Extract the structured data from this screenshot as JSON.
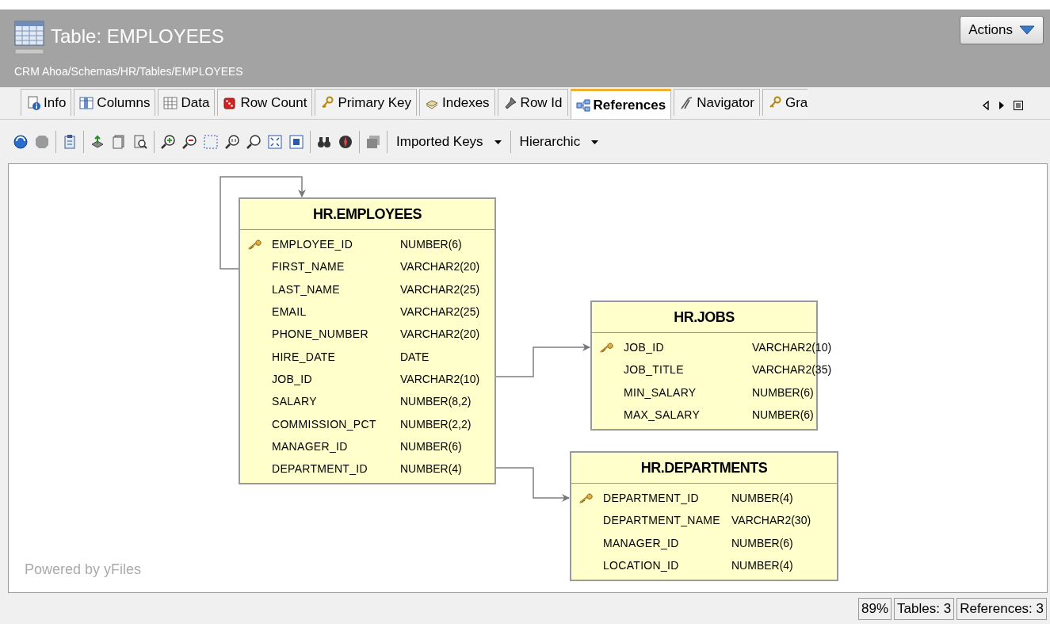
{
  "header": {
    "title": "Table: EMPLOYEES",
    "path": "CRM Ahoa/Schemas/HR/Tables/EMPLOYEES",
    "actions_button": "Actions"
  },
  "tabs": [
    {
      "label": "Info",
      "selected": false
    },
    {
      "label": "Columns",
      "selected": false
    },
    {
      "label": "Data",
      "selected": false
    },
    {
      "label": "Row Count",
      "selected": false
    },
    {
      "label": "Primary Key",
      "selected": false
    },
    {
      "label": "Indexes",
      "selected": false
    },
    {
      "label": "Row Id",
      "selected": false
    },
    {
      "label": "References",
      "selected": true
    },
    {
      "label": "Navigator",
      "selected": false
    },
    {
      "label": "Gra",
      "selected": false
    }
  ],
  "toolbar": {
    "dropdowns": [
      "Imported Keys",
      "Hierarchic"
    ]
  },
  "diagram": {
    "tables": [
      {
        "name": "HR.EMPLOYEES",
        "columns": [
          {
            "name": "EMPLOYEE_ID",
            "type": "NUMBER(6)",
            "primary_key": true
          },
          {
            "name": "FIRST_NAME",
            "type": "VARCHAR2(20)",
            "primary_key": false
          },
          {
            "name": "LAST_NAME",
            "type": "VARCHAR2(25)",
            "primary_key": false
          },
          {
            "name": "EMAIL",
            "type": "VARCHAR2(25)",
            "primary_key": false
          },
          {
            "name": "PHONE_NUMBER",
            "type": "VARCHAR2(20)",
            "primary_key": false
          },
          {
            "name": "HIRE_DATE",
            "type": "DATE",
            "primary_key": false
          },
          {
            "name": "JOB_ID",
            "type": "VARCHAR2(10)",
            "primary_key": false
          },
          {
            "name": "SALARY",
            "type": "NUMBER(8,2)",
            "primary_key": false
          },
          {
            "name": "COMMISSION_PCT",
            "type": "NUMBER(2,2)",
            "primary_key": false
          },
          {
            "name": "MANAGER_ID",
            "type": "NUMBER(6)",
            "primary_key": false
          },
          {
            "name": "DEPARTMENT_ID",
            "type": "NUMBER(4)",
            "primary_key": false
          }
        ]
      },
      {
        "name": "HR.JOBS",
        "columns": [
          {
            "name": "JOB_ID",
            "type": "VARCHAR2(10)",
            "primary_key": true
          },
          {
            "name": "JOB_TITLE",
            "type": "VARCHAR2(35)",
            "primary_key": false
          },
          {
            "name": "MIN_SALARY",
            "type": "NUMBER(6)",
            "primary_key": false
          },
          {
            "name": "MAX_SALARY",
            "type": "NUMBER(6)",
            "primary_key": false
          }
        ]
      },
      {
        "name": "HR.DEPARTMENTS",
        "columns": [
          {
            "name": "DEPARTMENT_ID",
            "type": "NUMBER(4)",
            "primary_key": true
          },
          {
            "name": "DEPARTMENT_NAME",
            "type": "VARCHAR2(30)",
            "primary_key": false
          },
          {
            "name": "MANAGER_ID",
            "type": "NUMBER(6)",
            "primary_key": false
          },
          {
            "name": "LOCATION_ID",
            "type": "NUMBER(4)",
            "primary_key": false
          }
        ]
      }
    ],
    "watermark": "Powered by yFiles"
  },
  "status_bar": [
    "89%",
    "Tables: 3",
    "References: 3"
  ]
}
